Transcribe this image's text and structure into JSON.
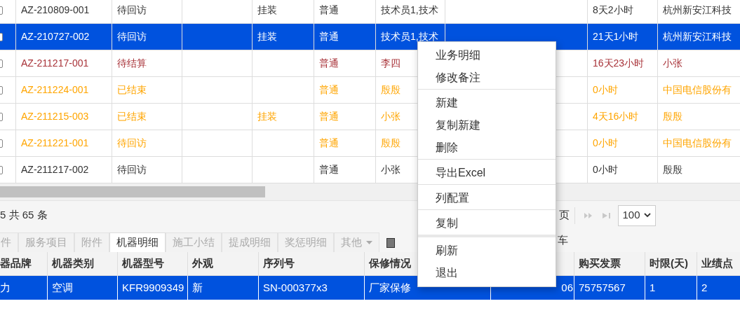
{
  "top_table": {
    "rows": [
      {
        "checked": false,
        "selected": false,
        "color": "#333333",
        "cells": {
          "column_1": "AZ-210809-001",
          "column_2": "待回访",
          "column_4": "挂装",
          "column_5": "普通",
          "column_6": "技术员1,技术",
          "column_8": "8天2小时",
          "column_9": "杭州新安江科技"
        }
      },
      {
        "checked": false,
        "selected": true,
        "color": "#ffffff",
        "cells": {
          "column_1": "AZ-210727-002",
          "column_2": "待回访",
          "column_4": "挂装",
          "column_5": "普通",
          "column_6": "技术员1,技术",
          "column_8": "21天1小时",
          "column_9": "杭州新安江科技"
        }
      },
      {
        "checked": false,
        "selected": false,
        "color": "#a83238",
        "cells": {
          "column_1": "AZ-211217-001",
          "column_2": "待结算",
          "column_5": "普通",
          "column_6": "李四",
          "column_8": "16天23小时",
          "column_9": "小张"
        }
      },
      {
        "checked": false,
        "selected": false,
        "color": "#ffa500",
        "cells": {
          "column_1": "AZ-211224-001",
          "column_2": "已结束",
          "column_5": "普通",
          "column_6": "殷殷",
          "column_8": "0小时",
          "column_9": "中国电信股份有"
        }
      },
      {
        "checked": false,
        "selected": false,
        "color": "#ffa500",
        "cells": {
          "column_1": "AZ-211215-003",
          "column_2": "已结束",
          "column_4": "挂装",
          "column_5": "普通",
          "column_6": "小张",
          "column_8": "4天16小时",
          "column_9": "殷殷"
        }
      },
      {
        "checked": false,
        "selected": false,
        "color": "#ffa500",
        "cells": {
          "column_1": "AZ-211221-001",
          "column_2": "待回访",
          "column_5": "普通",
          "column_6": "殷殷",
          "column_8": "0小时",
          "column_9": "中国电信股份有"
        }
      },
      {
        "checked": false,
        "selected": false,
        "color": "#333333",
        "cells": {
          "column_1": "AZ-211217-002",
          "column_2": "待回访",
          "column_5": "普通",
          "column_6": "小张",
          "column_8": "0小时",
          "column_9": "殷殷"
        }
      }
    ]
  },
  "pager": {
    "summary": "5 共 65 条",
    "page_suffix": "页",
    "page_size": "100"
  },
  "tabs": [
    {
      "label": "件",
      "selected": false
    },
    {
      "label": "服务项目",
      "selected": false
    },
    {
      "label": "附件",
      "selected": false
    },
    {
      "label": "机器明细",
      "selected": true
    },
    {
      "label": "施工小结",
      "selected": false
    },
    {
      "label": "提成明细",
      "selected": false
    },
    {
      "label": "奖惩明细",
      "selected": false
    },
    {
      "label": "其他",
      "selected": false,
      "dropdown": true
    }
  ],
  "tab_bar_text": "车",
  "bottom_table": {
    "columns": {
      "column_1": "器品牌",
      "column_2": "机器类别",
      "column_3": "机器型号",
      "column_4": "外观",
      "column_5": "序列号",
      "column_6": "保修情况",
      "column_8": "购买发票",
      "column_9": "时限(天)",
      "column_10": "业绩点"
    },
    "rows": [
      {
        "selected": true,
        "cells": {
          "column_1": "力",
          "column_2": "空调",
          "column_3": "KFR9909349",
          "column_4": "新",
          "column_5": "SN-000377x3",
          "column_6": "厂家保修",
          "column_7": "06",
          "column_8": "75757567",
          "column_9": "1",
          "column_10": "2"
        }
      }
    ]
  },
  "context_menu": {
    "groups": [
      [
        "业务明细",
        "修改备注"
      ],
      [
        "新建",
        "复制新建",
        "删除"
      ],
      [
        "导出Excel"
      ],
      [
        "列配置"
      ],
      [
        "复制"
      ],
      [
        "刷新",
        "退出"
      ]
    ]
  }
}
